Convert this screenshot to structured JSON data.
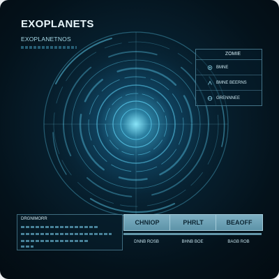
{
  "header": {
    "title": "EXOPLANETS",
    "subtitle": "EXOPLANETNOS"
  },
  "right_panel": {
    "title": "ZOMIE",
    "items": [
      {
        "label": "BMNE",
        "icon": "orbit-icon"
      },
      {
        "label": "BMNE BEERNS",
        "icon": "signal-icon"
      },
      {
        "label": "GRENNNEE",
        "icon": "globe-icon"
      }
    ]
  },
  "info_panel": {
    "title": "DRGNIMORR"
  },
  "buttons": [
    {
      "label": "CHNIOP",
      "caption": "DNNB ROSB"
    },
    {
      "label": "PHRLT",
      "caption": "BHNB BOE"
    },
    {
      "label": "BEAOFF",
      "caption": "BAGB ROB"
    }
  ],
  "colors": {
    "accent": "#5fd3f5",
    "button": "#6ea3b8",
    "background": "#04121b"
  }
}
